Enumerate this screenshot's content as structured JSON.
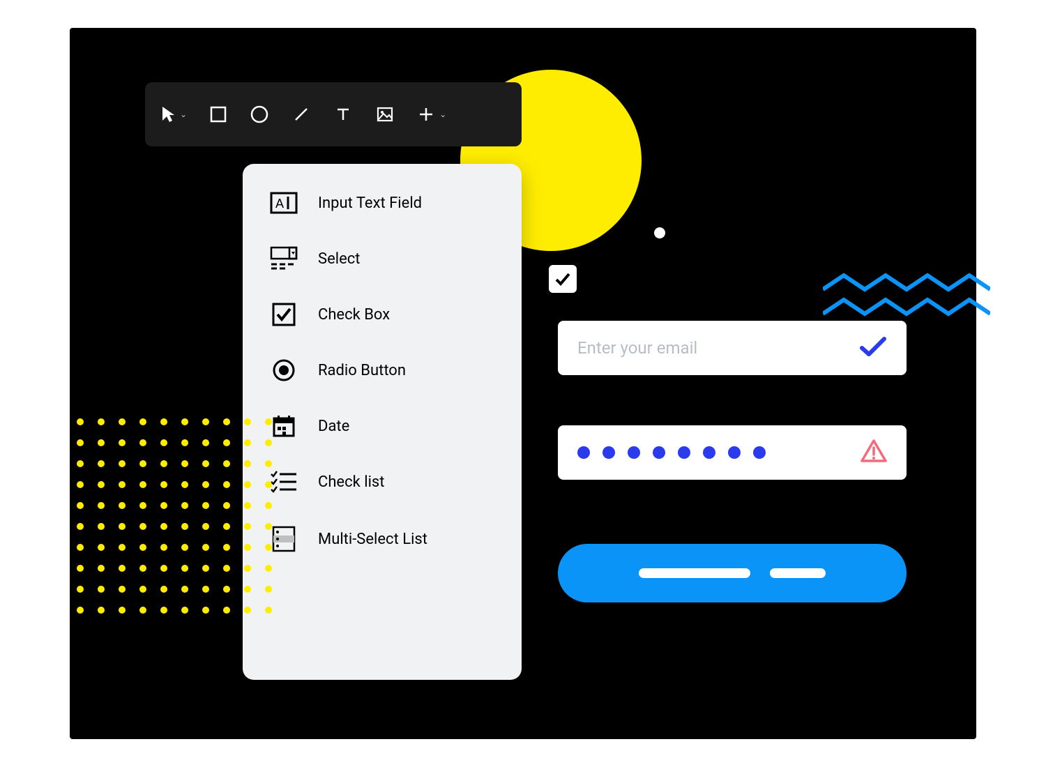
{
  "toolbar": {
    "items": [
      {
        "name": "selection-tool",
        "icon": "pointer",
        "dropdown": true
      },
      {
        "name": "rectangle-tool",
        "icon": "square",
        "dropdown": false
      },
      {
        "name": "ellipse-tool",
        "icon": "circle",
        "dropdown": false
      },
      {
        "name": "line-tool",
        "icon": "slash",
        "dropdown": false
      },
      {
        "name": "text-tool",
        "icon": "text",
        "dropdown": false
      },
      {
        "name": "image-tool",
        "icon": "image",
        "dropdown": false
      },
      {
        "name": "add-tool",
        "icon": "plus",
        "dropdown": true
      }
    ]
  },
  "menu": {
    "items": [
      {
        "name": "input-text-field",
        "icon": "text-field",
        "label": "Input Text Field"
      },
      {
        "name": "select",
        "icon": "select",
        "label": "Select"
      },
      {
        "name": "check-box",
        "icon": "checkbox",
        "label": "Check Box"
      },
      {
        "name": "radio-button",
        "icon": "radio",
        "label": "Radio Button"
      },
      {
        "name": "date",
        "icon": "calendar",
        "label": "Date"
      },
      {
        "name": "check-list",
        "icon": "checklist",
        "label": "Check list"
      },
      {
        "name": "multi-select-list",
        "icon": "multiselect",
        "label": "Multi-Select List"
      }
    ]
  },
  "form": {
    "email": {
      "placeholder": "Enter your email",
      "status": "valid"
    },
    "password": {
      "mask_chars": 8,
      "status": "warning"
    },
    "submit": {
      "label_parts": 2
    }
  },
  "colors": {
    "yellow": "#FFED00",
    "blue_accent": "#0B94F7",
    "indigo": "#2B3AED",
    "error": "#F46A7A",
    "zigzag": "#0B94F7"
  }
}
